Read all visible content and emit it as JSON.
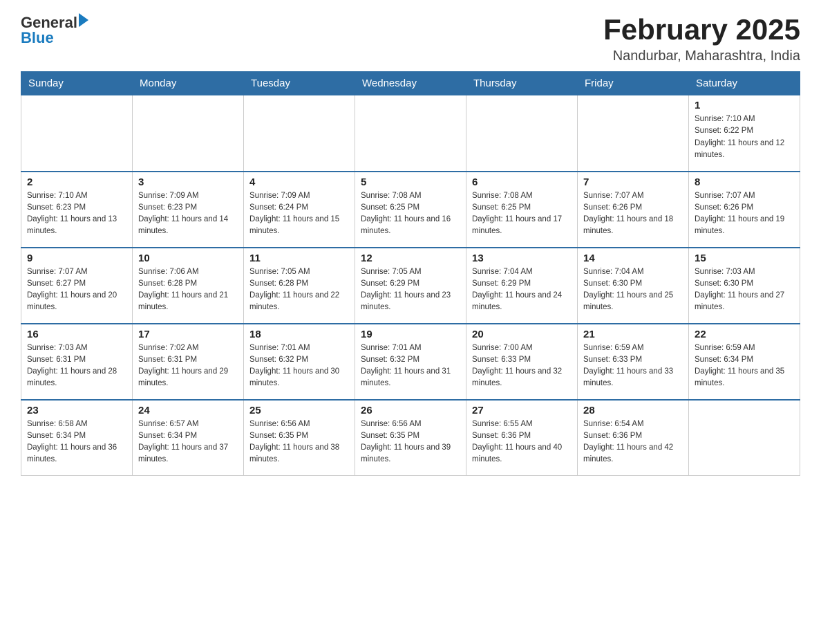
{
  "header": {
    "logo_general": "General",
    "logo_blue": "Blue",
    "title": "February 2025",
    "location": "Nandurbar, Maharashtra, India"
  },
  "weekdays": [
    "Sunday",
    "Monday",
    "Tuesday",
    "Wednesday",
    "Thursday",
    "Friday",
    "Saturday"
  ],
  "weeks": [
    {
      "days": [
        {
          "date": "",
          "info": ""
        },
        {
          "date": "",
          "info": ""
        },
        {
          "date": "",
          "info": ""
        },
        {
          "date": "",
          "info": ""
        },
        {
          "date": "",
          "info": ""
        },
        {
          "date": "",
          "info": ""
        },
        {
          "date": "1",
          "info": "Sunrise: 7:10 AM\nSunset: 6:22 PM\nDaylight: 11 hours and 12 minutes."
        }
      ]
    },
    {
      "days": [
        {
          "date": "2",
          "info": "Sunrise: 7:10 AM\nSunset: 6:23 PM\nDaylight: 11 hours and 13 minutes."
        },
        {
          "date": "3",
          "info": "Sunrise: 7:09 AM\nSunset: 6:23 PM\nDaylight: 11 hours and 14 minutes."
        },
        {
          "date": "4",
          "info": "Sunrise: 7:09 AM\nSunset: 6:24 PM\nDaylight: 11 hours and 15 minutes."
        },
        {
          "date": "5",
          "info": "Sunrise: 7:08 AM\nSunset: 6:25 PM\nDaylight: 11 hours and 16 minutes."
        },
        {
          "date": "6",
          "info": "Sunrise: 7:08 AM\nSunset: 6:25 PM\nDaylight: 11 hours and 17 minutes."
        },
        {
          "date": "7",
          "info": "Sunrise: 7:07 AM\nSunset: 6:26 PM\nDaylight: 11 hours and 18 minutes."
        },
        {
          "date": "8",
          "info": "Sunrise: 7:07 AM\nSunset: 6:26 PM\nDaylight: 11 hours and 19 minutes."
        }
      ]
    },
    {
      "days": [
        {
          "date": "9",
          "info": "Sunrise: 7:07 AM\nSunset: 6:27 PM\nDaylight: 11 hours and 20 minutes."
        },
        {
          "date": "10",
          "info": "Sunrise: 7:06 AM\nSunset: 6:28 PM\nDaylight: 11 hours and 21 minutes."
        },
        {
          "date": "11",
          "info": "Sunrise: 7:05 AM\nSunset: 6:28 PM\nDaylight: 11 hours and 22 minutes."
        },
        {
          "date": "12",
          "info": "Sunrise: 7:05 AM\nSunset: 6:29 PM\nDaylight: 11 hours and 23 minutes."
        },
        {
          "date": "13",
          "info": "Sunrise: 7:04 AM\nSunset: 6:29 PM\nDaylight: 11 hours and 24 minutes."
        },
        {
          "date": "14",
          "info": "Sunrise: 7:04 AM\nSunset: 6:30 PM\nDaylight: 11 hours and 25 minutes."
        },
        {
          "date": "15",
          "info": "Sunrise: 7:03 AM\nSunset: 6:30 PM\nDaylight: 11 hours and 27 minutes."
        }
      ]
    },
    {
      "days": [
        {
          "date": "16",
          "info": "Sunrise: 7:03 AM\nSunset: 6:31 PM\nDaylight: 11 hours and 28 minutes."
        },
        {
          "date": "17",
          "info": "Sunrise: 7:02 AM\nSunset: 6:31 PM\nDaylight: 11 hours and 29 minutes."
        },
        {
          "date": "18",
          "info": "Sunrise: 7:01 AM\nSunset: 6:32 PM\nDaylight: 11 hours and 30 minutes."
        },
        {
          "date": "19",
          "info": "Sunrise: 7:01 AM\nSunset: 6:32 PM\nDaylight: 11 hours and 31 minutes."
        },
        {
          "date": "20",
          "info": "Sunrise: 7:00 AM\nSunset: 6:33 PM\nDaylight: 11 hours and 32 minutes."
        },
        {
          "date": "21",
          "info": "Sunrise: 6:59 AM\nSunset: 6:33 PM\nDaylight: 11 hours and 33 minutes."
        },
        {
          "date": "22",
          "info": "Sunrise: 6:59 AM\nSunset: 6:34 PM\nDaylight: 11 hours and 35 minutes."
        }
      ]
    },
    {
      "days": [
        {
          "date": "23",
          "info": "Sunrise: 6:58 AM\nSunset: 6:34 PM\nDaylight: 11 hours and 36 minutes."
        },
        {
          "date": "24",
          "info": "Sunrise: 6:57 AM\nSunset: 6:34 PM\nDaylight: 11 hours and 37 minutes."
        },
        {
          "date": "25",
          "info": "Sunrise: 6:56 AM\nSunset: 6:35 PM\nDaylight: 11 hours and 38 minutes."
        },
        {
          "date": "26",
          "info": "Sunrise: 6:56 AM\nSunset: 6:35 PM\nDaylight: 11 hours and 39 minutes."
        },
        {
          "date": "27",
          "info": "Sunrise: 6:55 AM\nSunset: 6:36 PM\nDaylight: 11 hours and 40 minutes."
        },
        {
          "date": "28",
          "info": "Sunrise: 6:54 AM\nSunset: 6:36 PM\nDaylight: 11 hours and 42 minutes."
        },
        {
          "date": "",
          "info": ""
        }
      ]
    }
  ]
}
